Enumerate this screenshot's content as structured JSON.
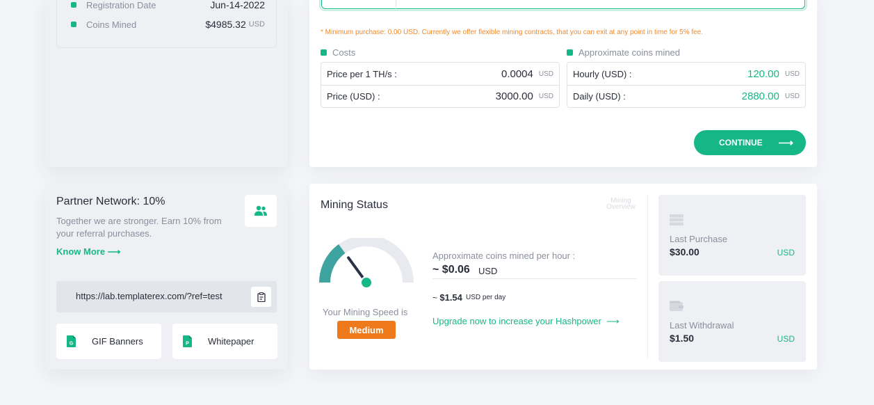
{
  "account": {
    "rows": [
      {
        "label": "Registration Date",
        "value": "Jun-14-2022",
        "unit": ""
      },
      {
        "label": "Coins Mined",
        "value": "$4985.32",
        "unit": "USD"
      }
    ]
  },
  "purchase": {
    "note": "* Minimum purchase: 0.00 USD. Currently we offer flexible mining contracts, that you can exit at any point in time for 5% fee.",
    "costs": {
      "title": "Costs",
      "rows": [
        {
          "label": "Price per 1 TH/s :",
          "value": "0.0004",
          "unit": "USD"
        },
        {
          "label": "Price (USD) :",
          "value": "3000.00",
          "unit": "USD"
        }
      ]
    },
    "coins": {
      "title": "Approximate coins mined",
      "rows": [
        {
          "label": "Hourly (USD) :",
          "value": "120.00",
          "unit": "USD"
        },
        {
          "label": "Daily (USD) :",
          "value": "2880.00",
          "unit": "USD"
        }
      ]
    },
    "continue_label": "CONTINUE"
  },
  "partner": {
    "title": "Partner Network: 10%",
    "description": "Together we are stronger. Earn 10% from your referral purchases.",
    "know_more": "Know More",
    "ref_link": "https://lab.templaterex.com/?ref=test",
    "gif_banners": "GIF Banners",
    "whitepaper": "Whitepaper"
  },
  "mining": {
    "title": "Mining Status",
    "overview_label": "Mining Overview",
    "speed_label": "Your Mining Speed is",
    "speed_value": "Medium",
    "speed_level": 0.3,
    "approx_label": "Approximate coins mined per hour :",
    "per_hour": "~ $0.06",
    "per_hour_unit": "USD",
    "per_day_prefix": "~",
    "per_day": "$1.54",
    "per_day_unit": "USD per day",
    "upgrade_label": "Upgrade now to increase your Hashpower",
    "last_purchase": {
      "label": "Last Purchase",
      "value": "$30.00",
      "currency": "USD"
    },
    "last_withdrawal": {
      "label": "Last Withdrawal",
      "value": "$1.50",
      "currency": "USD"
    }
  },
  "colors": {
    "accent": "#16b786",
    "warning": "#ee7a1c",
    "note": "#f08a2b",
    "needle": "#2b2f4a",
    "gauge_teal": "#3fa3a0"
  }
}
